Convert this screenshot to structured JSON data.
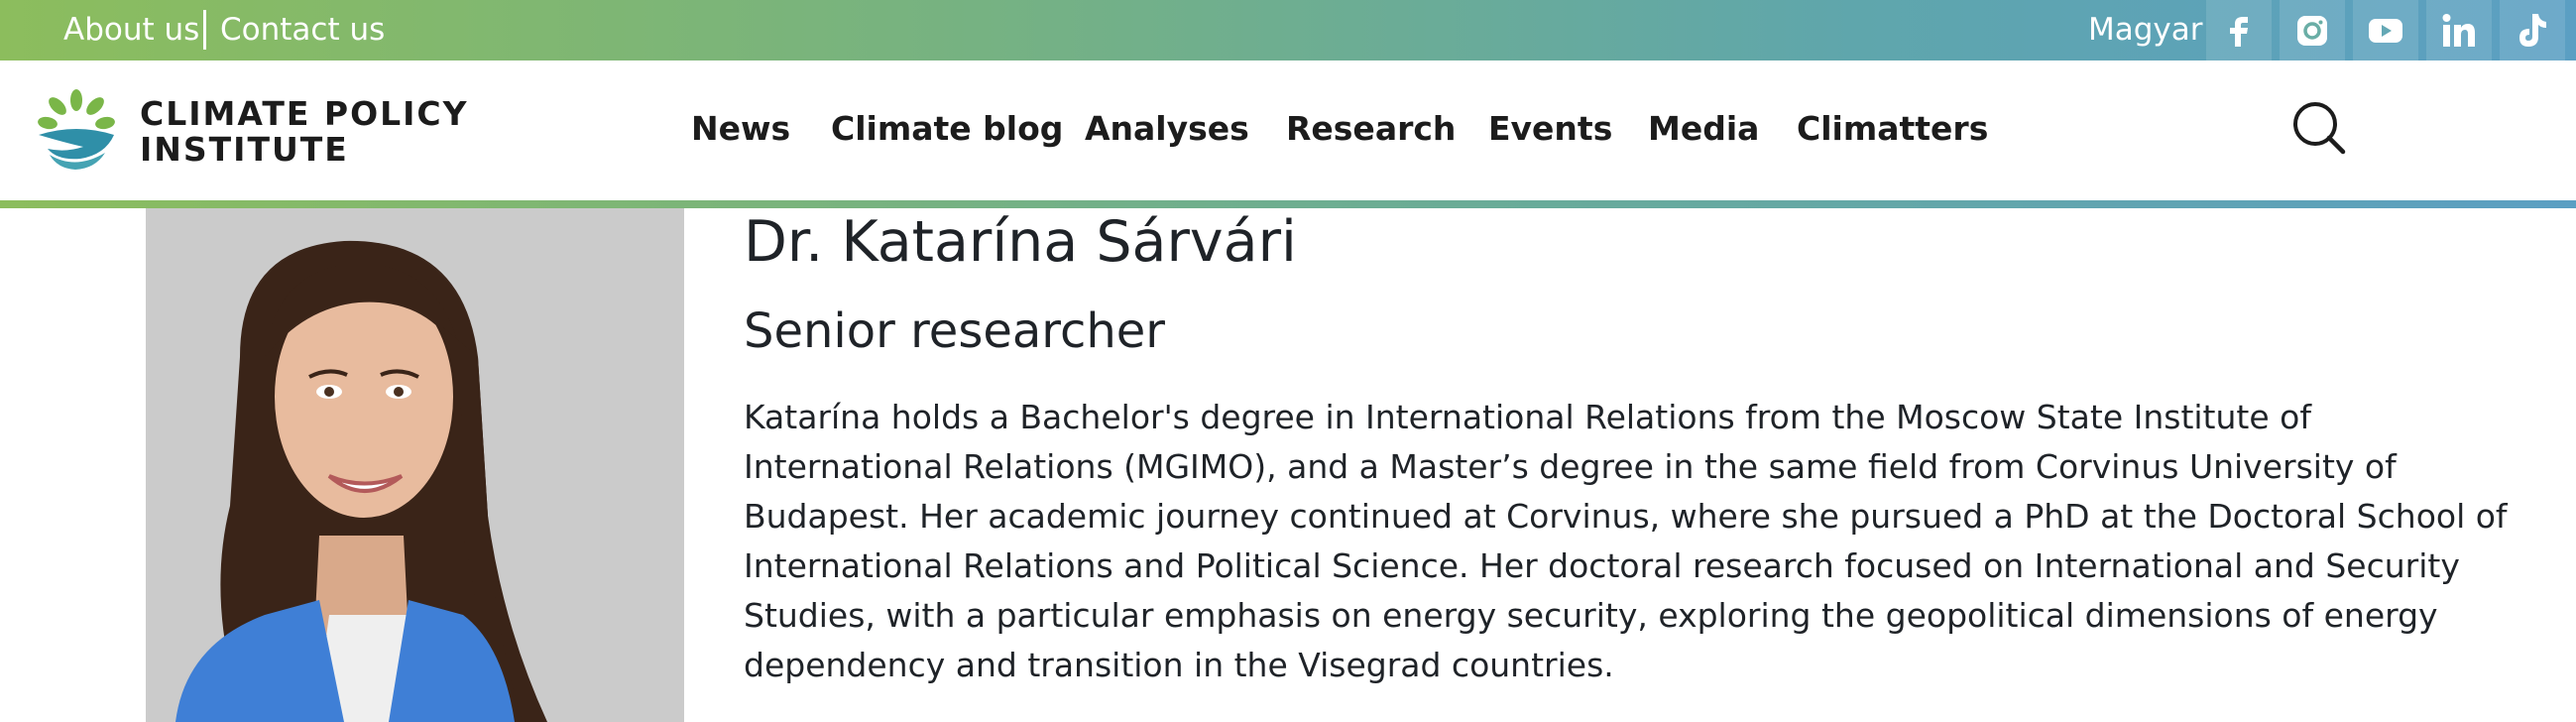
{
  "topbar": {
    "links": [
      "About us",
      "Contact us"
    ],
    "language": "Magyar",
    "socials": [
      {
        "icon": "facebook-icon"
      },
      {
        "icon": "instagram-icon"
      },
      {
        "icon": "youtube-icon"
      },
      {
        "icon": "linkedin-icon"
      },
      {
        "icon": "tiktok-icon"
      }
    ],
    "gradient": [
      "#8cbd5d",
      "#5b9fc3"
    ]
  },
  "logo": {
    "line1": "CLIMATE POLICY",
    "line2": "INSTITUTE",
    "colors": [
      "#7ab648",
      "#2f8fa8"
    ]
  },
  "nav": {
    "items": [
      "News",
      "Climate blog",
      "Analyses",
      "Research",
      "Events",
      "Media",
      "Climatters"
    ],
    "search_icon": "search-icon"
  },
  "profile": {
    "name": "Dr. Katarína Sárvári",
    "role": "Senior researcher",
    "bio": "Katarína holds a Bachelor's degree in International Relations from the Moscow State Institute of International Relations (MGIMO), and a Master’s degree in the same field from Corvinus University of Budapest. Her academic journey continued at Corvinus, where she pursued a PhD at the Doctoral School of International Relations and Political Science. Her doctoral research focused on International and Security Studies, with a particular emphasis on energy security, exploring the geopolitical dimensions of energy dependency and transition in the Visegrad countries."
  }
}
